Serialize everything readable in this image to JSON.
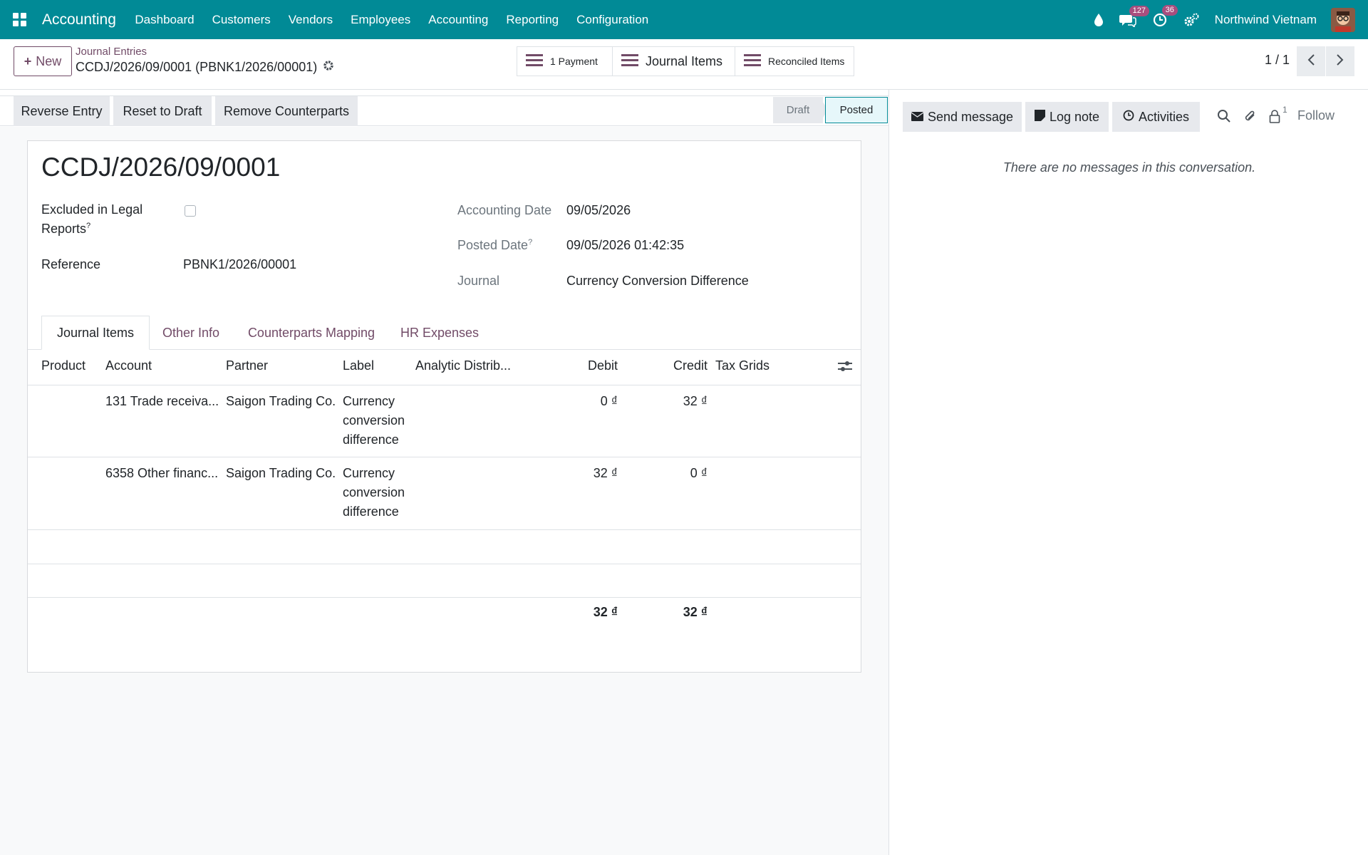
{
  "topbar": {
    "brand": "Accounting",
    "menu": [
      "Dashboard",
      "Customers",
      "Vendors",
      "Employees",
      "Accounting",
      "Reporting",
      "Configuration"
    ],
    "messages_badge": "127",
    "activities_badge": "36",
    "company": "Northwind Vietnam"
  },
  "control": {
    "new_label": "New",
    "breadcrumb": "Journal Entries",
    "record_name": "CCDJ/2026/09/0001 (PBNK1/2026/00001)",
    "smart_buttons": [
      "1 Payment",
      "Journal Items",
      "Reconciled Items"
    ],
    "pager": "1 / 1"
  },
  "actions": {
    "reverse": "Reverse Entry",
    "reset": "Reset to Draft",
    "remove": "Remove Counterparts"
  },
  "status": {
    "draft": "Draft",
    "posted": "Posted"
  },
  "form": {
    "title": "CCDJ/2026/09/0001",
    "excluded_label_1": "Excluded in Legal",
    "excluded_label_2": "Reports",
    "help_mark": "?",
    "reference_label": "Reference",
    "reference_value": "PBNK1/2026/00001",
    "accounting_date_label": "Accounting Date",
    "accounting_date_value": "09/05/2026",
    "posted_date_label": "Posted Date",
    "posted_date_value": "09/05/2026 01:42:35",
    "journal_label": "Journal",
    "journal_value": "Currency Conversion Difference"
  },
  "tabs": [
    "Journal Items",
    "Other Info",
    "Counterparts Mapping",
    "HR Expenses"
  ],
  "table": {
    "headers": [
      "Product",
      "Account",
      "Partner",
      "Label",
      "Analytic Distrib...",
      "Debit",
      "Credit",
      "Tax Grids"
    ],
    "rows": [
      {
        "product": "",
        "account": "131 Trade receiva...",
        "partner": "Saigon Trading Co.",
        "label": [
          "Currency",
          "conversion",
          "difference"
        ],
        "debit": "0 ₫",
        "credit": "32 ₫"
      },
      {
        "product": "",
        "account": "6358 Other financ...",
        "partner": "Saigon Trading Co.",
        "label": [
          "Currency",
          "conversion",
          "difference"
        ],
        "debit": "32 ₫",
        "credit": "0 ₫"
      }
    ],
    "total_debit": "32 ₫",
    "total_credit": "32 ₫"
  },
  "chatter": {
    "send_message": "Send message",
    "log_note": "Log note",
    "activities": "Activities",
    "followers_count": "1",
    "follow": "Follow",
    "empty": "There are no messages in this conversation."
  },
  "colors": {
    "topbar": "#018a96",
    "brand_purple": "#714b67",
    "button_grey": "#e7e9ed"
  }
}
